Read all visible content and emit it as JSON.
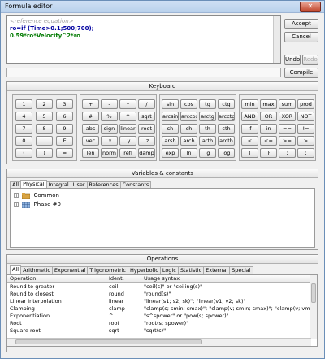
{
  "window": {
    "title": "Formula editor",
    "close_glyph": "✕"
  },
  "editor": {
    "hint": "<reference equation>",
    "line2": "ro=if (Time>0.1;500;700);",
    "line3": "0.59*ro*Velocity^2*ro"
  },
  "buttons": {
    "accept": "Accept",
    "cancel": "Cancel",
    "undo": "Undo",
    "redo": "Redo",
    "compile": "Compile"
  },
  "keyboard": {
    "title": "Keyboard",
    "digits": [
      [
        "1",
        "2",
        "3"
      ],
      [
        "4",
        "5",
        "6"
      ],
      [
        "7",
        "8",
        "9"
      ],
      [
        "0",
        ".",
        "E"
      ],
      [
        "(",
        ")",
        "="
      ]
    ],
    "operators": [
      [
        "+",
        "-",
        "*",
        "/"
      ],
      [
        "#",
        "%",
        "^",
        "sqrt"
      ],
      [
        "abs",
        "sign",
        "linear",
        "root"
      ],
      [
        "vec",
        ".x",
        ".y",
        ".z"
      ],
      [
        "len",
        "norm",
        "refl",
        "damp"
      ]
    ],
    "trig": [
      [
        "sin",
        "cos",
        "tg",
        "ctg"
      ],
      [
        "arcsin",
        "arccos",
        "arctg",
        "arcctg"
      ],
      [
        "sh",
        "ch",
        "th",
        "cth"
      ],
      [
        "arsh",
        "arch",
        "arth",
        "arcth"
      ],
      [
        "exp",
        "ln",
        "lg",
        "log"
      ]
    ],
    "logic": [
      [
        "min",
        "max",
        "sum",
        "prod"
      ],
      [
        "AND",
        "OR",
        "XOR",
        "NOT"
      ],
      [
        "if",
        "in",
        "==",
        "!="
      ],
      [
        "<",
        "<=",
        ">=",
        ">"
      ],
      [
        "{",
        "}",
        ";",
        ";"
      ]
    ]
  },
  "variables": {
    "title": "Variables & constants",
    "tabs": [
      "All",
      "Physical",
      "Integral",
      "User",
      "References",
      "Constants"
    ],
    "active_tab": "Physical",
    "tree": [
      {
        "label": "Common",
        "expander": "+"
      },
      {
        "label": "Phase #0",
        "expander": "+"
      }
    ]
  },
  "operations": {
    "title": "Operations",
    "tabs": [
      "All",
      "Arithmetic",
      "Exponential",
      "Trigonometric",
      "Hyperbolic",
      "Logic",
      "Statistic",
      "External",
      "Special"
    ],
    "active_tab": "All",
    "columns": [
      "Operation",
      "Ident.",
      "Usage syntax"
    ],
    "rows": [
      [
        "Round to greater",
        "ceil",
        "\"ceil(s)\" or \"ceiling(s)\""
      ],
      [
        "Round to closest",
        "round",
        "\"round(s)\""
      ],
      [
        "Linear interpolation",
        "linear",
        "\"linear(s1; s2; sk)\"; \"linear(v1; v2; sk)\""
      ],
      [
        "Clamping",
        "clamp",
        "\"clamp(s; smin; smax)\"; \"clamp(v; smin; smax)\"; \"clamp(v; vmin; v"
      ],
      [
        "Exponentiation",
        "^",
        "\"s^spower\" or \"pow(s; spower)\""
      ],
      [
        "Root",
        "root",
        "\"root(s; spower)\""
      ],
      [
        "Square root",
        "sqrt",
        "\"sqrt(s)\""
      ]
    ]
  },
  "colors": {
    "accent": "#6b8fb8",
    "hint": "#a0a0a0",
    "line2": "#0000a0",
    "line3": "#007a00"
  }
}
